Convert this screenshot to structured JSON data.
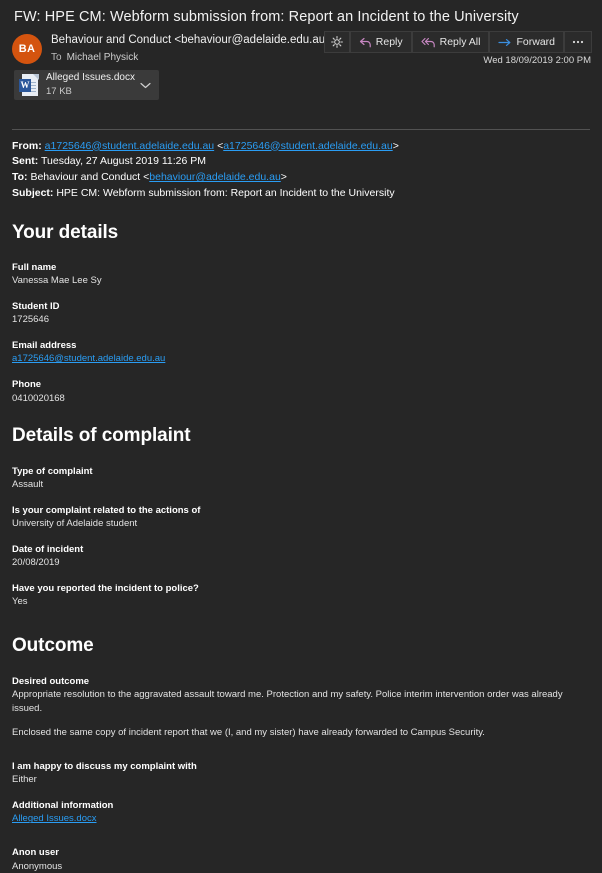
{
  "window": {
    "subject": "FW: HPE CM: Webform submission from: Report an Incident to the University"
  },
  "header": {
    "avatar_initials": "BA",
    "sender": "Behaviour and Conduct <behaviour@adelaide.edu.au>",
    "to_label": "To",
    "to_recipients": "Michael Physick",
    "timestamp": "Wed 18/09/2019 2:00 PM",
    "actions": [
      {
        "name": "brightness-button",
        "label": "",
        "icon": "brightness-icon"
      },
      {
        "name": "reply-button",
        "label": "Reply",
        "icon": "reply-arrow-icon"
      },
      {
        "name": "reply-all-button",
        "label": "Reply All",
        "icon": "reply-all-arrow-icon"
      },
      {
        "name": "forward-button",
        "label": "Forward",
        "icon": "forward-arrow-icon"
      },
      {
        "name": "more-actions-button",
        "label": "",
        "icon": "ellipsis-icon"
      }
    ],
    "accent_reply": "#c586c0",
    "accent_forward": "#3b8fe0",
    "avatar_color": "#d4540f"
  },
  "attachment": {
    "filename": "Alleged Issues.docx",
    "size": "17 KB",
    "icon": "word-document-icon",
    "badge_letter": "W",
    "chevron": "chevron-down-icon"
  },
  "message_headers": {
    "from_label": "From:",
    "from_value_1": "a1725646@student.adelaide.edu.au",
    "from_bracket_open": " <",
    "from_value_2": "a1725646@student.adelaide.edu.au",
    "from_bracket_close": ">",
    "sent_label": "Sent:",
    "sent_value": "Tuesday, 27 August 2019 11:26 PM",
    "to_label": "To:",
    "to_name": "Behaviour and Conduct <",
    "to_email": "behaviour@adelaide.edu.au",
    "to_close": ">",
    "subject_label": "Subject:",
    "subject_value": "HPE CM: Webform submission from: Report an Incident to the University"
  },
  "sections": {
    "your_details": {
      "heading": "Your details",
      "fields": [
        {
          "label": "Full name",
          "value": "Vanessa Mae Lee Sy"
        },
        {
          "label": "Student ID",
          "value": "1725646"
        },
        {
          "label": "Email address",
          "value": "a1725646@student.adelaide.edu.au",
          "is_link": true
        },
        {
          "label": "Phone",
          "value": "0410020168"
        }
      ]
    },
    "details_of_complaint": {
      "heading": "Details of complaint",
      "fields": [
        {
          "label": "Type of complaint",
          "value": "Assault"
        },
        {
          "label": "Is your complaint related to the actions of",
          "value": "University of Adelaide student"
        },
        {
          "label": "Date of incident",
          "value": "20/08/2019"
        },
        {
          "label": "Have you reported the incident to police?",
          "value": "Yes"
        }
      ]
    },
    "outcome": {
      "heading": "Outcome",
      "desired_outcome_label": "Desired outcome",
      "desired_outcome_value": "Appropriate resolution to the aggravated assault toward me. Protection and my safety. Police interim intervention order was already issued.",
      "desired_outcome_para2": "Enclosed the same copy of incident report that we (I, and my sister) have already forwarded to Campus Security.",
      "discuss_label": "I am happy to discuss my complaint with",
      "discuss_value": "Either",
      "additional_label": "Additional information",
      "additional_value": "Alleged Issues.docx",
      "anon_label": "Anon user",
      "anon_value": "Anonymous"
    }
  }
}
